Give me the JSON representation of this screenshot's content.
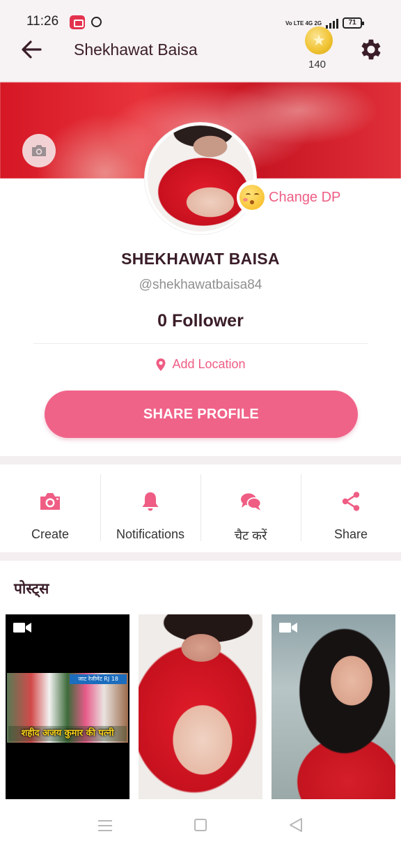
{
  "status_bar": {
    "time": "11:26",
    "network_labels": "Vo LTE  4G  2G",
    "battery": "71"
  },
  "app_bar": {
    "title": "Shekhawat Baisa",
    "coins": "140"
  },
  "profile": {
    "name": "SHEKHAWAT BAISA",
    "handle": "@shekhawatbaisa84",
    "followers": "0 Follower",
    "change_dp_label": "Change DP",
    "add_location_label": "Add Location",
    "share_profile_label": "SHARE PROFILE"
  },
  "actions": [
    {
      "label": "Create",
      "icon": "camera-icon"
    },
    {
      "label": "Notifications",
      "icon": "bell-icon"
    },
    {
      "label": "चैट करें",
      "icon": "chat-icon"
    },
    {
      "label": "Share",
      "icon": "share-icon"
    }
  ],
  "posts": {
    "heading": "पोस्ट्स",
    "items": [
      {
        "type": "video",
        "banner": "जाट रेजीमेंट RJ 18",
        "caption": "शहीद अजय कुमार की पत्नी"
      },
      {
        "type": "image"
      },
      {
        "type": "video"
      }
    ]
  },
  "colors": {
    "accent": "#f06389",
    "accent_text": "#ef5d84",
    "title_text": "#3a1d28",
    "cover_red": "#d61725"
  }
}
